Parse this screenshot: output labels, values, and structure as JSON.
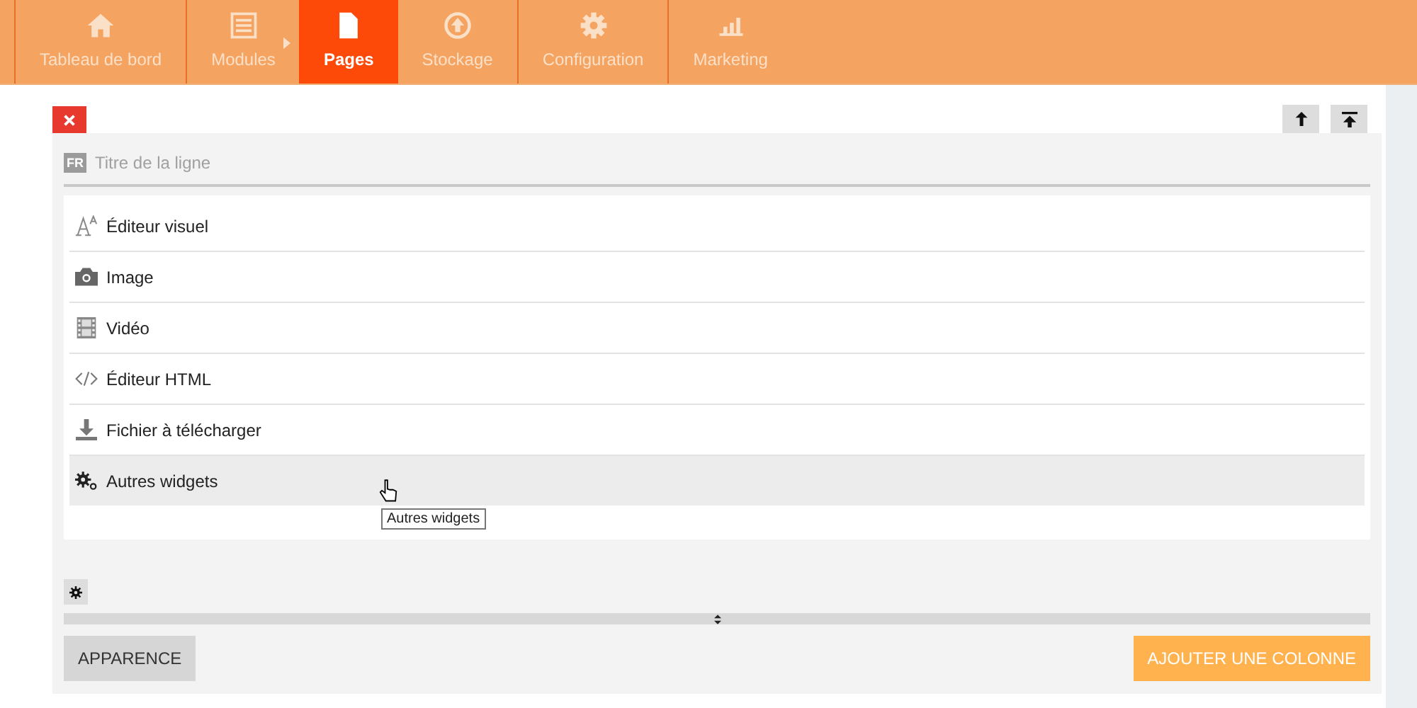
{
  "nav": [
    {
      "label": "Tableau de bord",
      "selected": false,
      "submenu": false
    },
    {
      "label": "Modules",
      "selected": false,
      "submenu": true
    },
    {
      "label": "Pages",
      "selected": true,
      "submenu": false
    },
    {
      "label": "Stockage",
      "selected": false,
      "submenu": false
    },
    {
      "label": "Configuration",
      "selected": false,
      "submenu": false
    },
    {
      "label": "Marketing",
      "selected": false,
      "submenu": false
    }
  ],
  "title_field": {
    "lang": "FR",
    "placeholder": "Titre de la ligne"
  },
  "widgets": [
    {
      "label": "Éditeur visuel",
      "kind": "text",
      "hovered": false
    },
    {
      "label": "Image",
      "kind": "camera",
      "hovered": false
    },
    {
      "label": "Vidéo",
      "kind": "film",
      "hovered": false
    },
    {
      "label": "Éditeur HTML",
      "kind": "code",
      "hovered": false
    },
    {
      "label": "Fichier à télécharger",
      "kind": "download",
      "hovered": false
    },
    {
      "label": "Autres widgets",
      "kind": "gears",
      "hovered": true
    }
  ],
  "tooltip": "Autres widgets",
  "buttons": {
    "appearance": "APPARENCE",
    "add_column": "AJOUTER UNE COLONNE"
  }
}
